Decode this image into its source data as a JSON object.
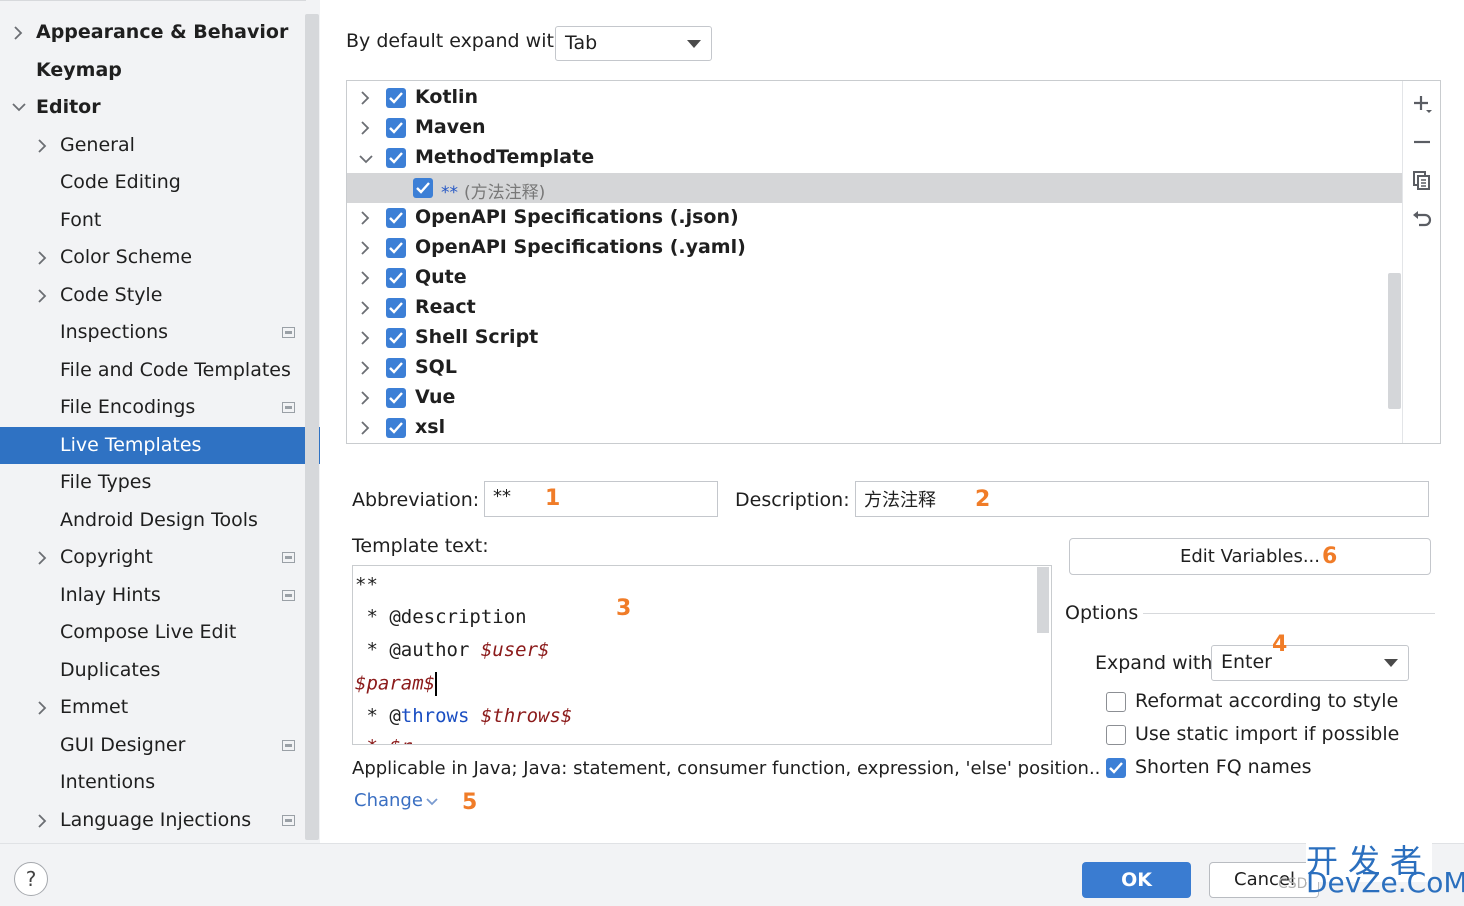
{
  "sidebar": {
    "items": [
      {
        "label": "Appearance & Behavior",
        "chevron": "right",
        "indent": 0,
        "bold": true
      },
      {
        "label": "Keymap",
        "chevron": "",
        "indent": 0,
        "bold": true
      },
      {
        "label": "Editor",
        "chevron": "down",
        "indent": 0,
        "bold": true
      },
      {
        "label": "General",
        "chevron": "right",
        "indent": 1
      },
      {
        "label": "Code Editing",
        "chevron": "",
        "indent": 1
      },
      {
        "label": "Font",
        "chevron": "",
        "indent": 1
      },
      {
        "label": "Color Scheme",
        "chevron": "right",
        "indent": 1
      },
      {
        "label": "Code Style",
        "chevron": "right",
        "indent": 1
      },
      {
        "label": "Inspections",
        "chevron": "",
        "indent": 1,
        "project_icon": true
      },
      {
        "label": "File and Code Templates",
        "chevron": "",
        "indent": 1
      },
      {
        "label": "File Encodings",
        "chevron": "",
        "indent": 1,
        "project_icon": true
      },
      {
        "label": "Live Templates",
        "chevron": "",
        "indent": 1,
        "selected": true
      },
      {
        "label": "File Types",
        "chevron": "",
        "indent": 1
      },
      {
        "label": "Android Design Tools",
        "chevron": "",
        "indent": 1
      },
      {
        "label": "Copyright",
        "chevron": "right",
        "indent": 1,
        "project_icon": true
      },
      {
        "label": "Inlay Hints",
        "chevron": "",
        "indent": 1,
        "project_icon": true
      },
      {
        "label": "Compose Live Edit",
        "chevron": "",
        "indent": 1
      },
      {
        "label": "Duplicates",
        "chevron": "",
        "indent": 1
      },
      {
        "label": "Emmet",
        "chevron": "right",
        "indent": 1
      },
      {
        "label": "GUI Designer",
        "chevron": "",
        "indent": 1,
        "project_icon": true
      },
      {
        "label": "Intentions",
        "chevron": "",
        "indent": 1
      },
      {
        "label": "Language Injections",
        "chevron": "right",
        "indent": 1,
        "project_icon": true
      }
    ]
  },
  "top": {
    "expand_label": "By default expand with",
    "expand_value": "Tab"
  },
  "tree": {
    "rows": [
      {
        "label": "Kotlin",
        "chevron": "right",
        "checked": true
      },
      {
        "label": "Maven",
        "chevron": "right",
        "checked": true
      },
      {
        "label": "MethodTemplate",
        "chevron": "down",
        "checked": true
      },
      {
        "label": "(方法注释)",
        "abbr": "**",
        "child": true,
        "checked": true,
        "selected": true
      },
      {
        "label": "OpenAPI Specifications (.json)",
        "chevron": "right",
        "checked": true
      },
      {
        "label": "OpenAPI Specifications (.yaml)",
        "chevron": "right",
        "checked": true
      },
      {
        "label": "Qute",
        "chevron": "right",
        "checked": true
      },
      {
        "label": "React",
        "chevron": "right",
        "checked": true
      },
      {
        "label": "Shell Script",
        "chevron": "right",
        "checked": true
      },
      {
        "label": "SQL",
        "chevron": "right",
        "checked": true
      },
      {
        "label": "Vue",
        "chevron": "right",
        "checked": true
      },
      {
        "label": "xsl",
        "chevron": "right",
        "checked": true
      }
    ],
    "toolbar": [
      "add-icon",
      "remove-icon",
      "copy-icon",
      "undo-icon"
    ]
  },
  "form": {
    "abbreviation_label": "Abbreviation:",
    "abbreviation_value": "**",
    "description_label": "Description:",
    "description_value": "方法注释",
    "template_text_label": "Template text:",
    "template_lines": {
      "l1": "**",
      "l2_prefix": " * @description",
      "l3_prefix": " * @author ",
      "l3_var": "$user$",
      "l4_var": "$param$",
      "l5_prefix": " * @",
      "l5_kw": "throws",
      "l5_var": "$throws$",
      "l6_partial": " * $r..."
    },
    "applicable_text": "Applicable in Java; Java: statement, consumer function, expression, 'else' position..",
    "change_link": "Change"
  },
  "options": {
    "edit_variables_label": "Edit Variables...",
    "options_label": "Options",
    "expand_with_label": "Expand with",
    "expand_with_value": "Enter",
    "reformat_label": "Reformat according to style",
    "reformat_checked": false,
    "static_import_label": "Use static import if possible",
    "static_import_checked": false,
    "shorten_fq_label": "Shorten FQ names",
    "shorten_fq_checked": true
  },
  "annotations": {
    "n1": "1",
    "n2": "2",
    "n3": "3",
    "n4": "4",
    "n5": "5",
    "n6": "6"
  },
  "footer": {
    "help_label": "?",
    "ok_label": "OK",
    "cancel_label": "Cancel",
    "watermark_cn": "开发者",
    "watermark_en": "DevZe.CoM",
    "watermark_small": "CSD"
  },
  "colors": {
    "selection_blue": "#2f72c3",
    "checkbox_blue": "#3c7fd6",
    "annotation_orange": "#f07c28",
    "template_var": "#8b1a1a",
    "keyword_blue": "#1a4ec2"
  }
}
